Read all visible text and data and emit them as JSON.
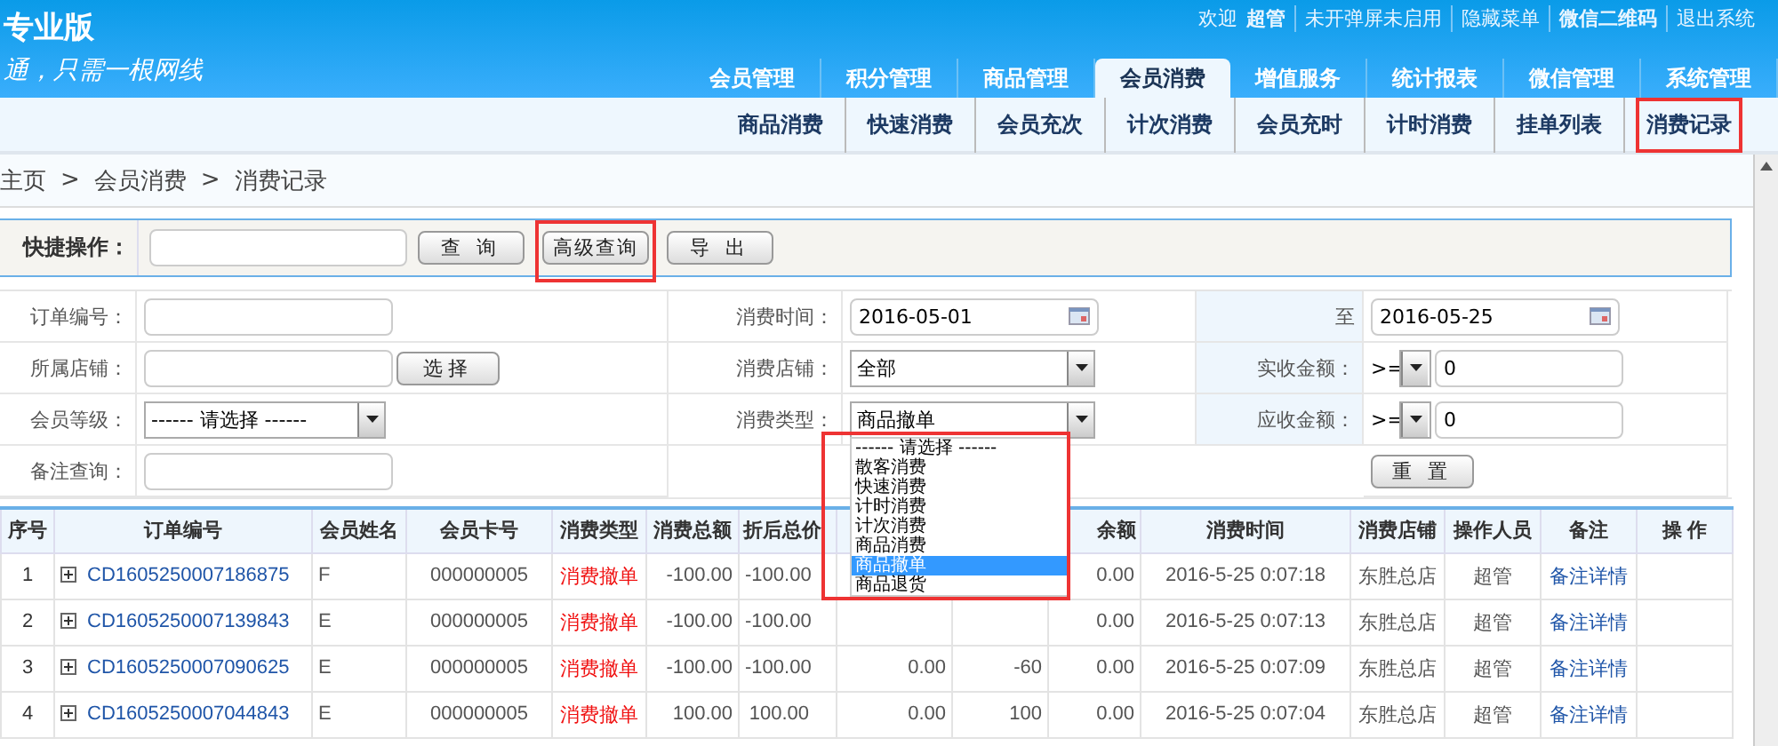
{
  "header": {
    "edition": "专业版",
    "slogan": "通，只需一根网线",
    "top_links": [
      [
        {
          "text": "欢迎",
          "bold": false
        },
        {
          "text": "超管",
          "bold": true
        }
      ],
      [
        {
          "text": "未开弹屏未启用",
          "bold": false
        }
      ],
      [
        {
          "text": "隐藏菜单",
          "bold": false
        }
      ],
      [
        {
          "text": "微信二维码",
          "bold": true
        }
      ],
      [
        {
          "text": "退出系统",
          "bold": false
        }
      ]
    ],
    "nav_tabs": [
      {
        "label": "会员管理",
        "selected": false
      },
      {
        "label": "积分管理",
        "selected": false
      },
      {
        "label": "商品管理",
        "selected": false
      },
      {
        "label": "会员消费",
        "selected": true
      },
      {
        "label": "增值服务",
        "selected": false
      },
      {
        "label": "统计报表",
        "selected": false
      },
      {
        "label": "微信管理",
        "selected": false
      },
      {
        "label": "系统管理",
        "selected": false
      }
    ]
  },
  "sub_nav": [
    {
      "label": "商品消费",
      "highlighted": false
    },
    {
      "label": "快速消费",
      "highlighted": false
    },
    {
      "label": "会员充次",
      "highlighted": false
    },
    {
      "label": "计次消费",
      "highlighted": false
    },
    {
      "label": "会员充时",
      "highlighted": false
    },
    {
      "label": "计时消费",
      "highlighted": false
    },
    {
      "label": "挂单列表",
      "highlighted": false
    },
    {
      "label": "消费记录",
      "highlighted": true
    }
  ],
  "breadcrumb": {
    "separator": ">",
    "items": [
      "主页",
      "会员消费",
      "消费记录"
    ]
  },
  "quick_bar": {
    "label": "快捷操作：",
    "buttons": [
      {
        "label": "查 询",
        "highlighted": false
      },
      {
        "label": "高级查询",
        "highlighted": true
      },
      {
        "label": "导 出",
        "highlighted": false
      }
    ]
  },
  "advanced_form": [
    [
      {
        "kind": "label",
        "text": "订单编号："
      },
      {
        "kind": "input"
      },
      {
        "kind": "label",
        "text": "消费时间："
      },
      {
        "kind": "date",
        "value": "2016-05-01"
      },
      {
        "kind": "label",
        "text": "至"
      },
      {
        "kind": "date",
        "value": "2016-05-25"
      }
    ],
    [
      {
        "kind": "label",
        "text": "所属店铺："
      },
      {
        "kind": "input_button",
        "button": "选择"
      },
      {
        "kind": "label",
        "text": "消费店铺："
      },
      {
        "kind": "select",
        "value": "全部",
        "expanded": false
      },
      {
        "kind": "label",
        "text": "实收金额："
      },
      {
        "kind": "compare",
        "operator": ">=",
        "value": "0"
      }
    ],
    [
      {
        "kind": "label",
        "text": "会员等级："
      },
      {
        "kind": "select",
        "value": "------ 请选择 ------",
        "expanded": false
      },
      {
        "kind": "label",
        "text": "消费类型："
      },
      {
        "kind": "select",
        "value": "商品撤单",
        "expanded": true,
        "highlighted": true,
        "options": [
          {
            "label": "------ 请选择 ------",
            "selected": false
          },
          {
            "label": "散客消费",
            "selected": false
          },
          {
            "label": "快速消费",
            "selected": false
          },
          {
            "label": "计时消费",
            "selected": false
          },
          {
            "label": "计次消费",
            "selected": false
          },
          {
            "label": "商品消费",
            "selected": false
          },
          {
            "label": "商品撤单",
            "selected": true
          },
          {
            "label": "商品退货",
            "selected": false
          }
        ]
      },
      {
        "kind": "label",
        "text": "应收金额："
      },
      {
        "kind": "compare",
        "operator": ">=",
        "value": "0"
      }
    ],
    [
      {
        "kind": "label",
        "text": "备注查询："
      },
      {
        "kind": "input"
      },
      {
        "kind": "empty"
      },
      {
        "kind": "empty"
      },
      {
        "kind": "empty"
      },
      {
        "kind": "button",
        "label": "重 置"
      }
    ]
  ],
  "table": {
    "columns": [
      "序号",
      "订单编号",
      "会员姓名",
      "会员卡号",
      "消费类型",
      "消费总额",
      "折后总价",
      null,
      null,
      "余额",
      "消费时间",
      "消费店铺",
      "操作人员",
      "备注",
      "操 作"
    ],
    "rows": [
      [
        "1",
        "CD1605250007186875",
        "F",
        "000000005",
        "消费撤单",
        "-100.00",
        "-100.00",
        null,
        null,
        "0.00",
        "2016-5-25 0:07:18",
        "东胜总店",
        "超管",
        "备注详情"
      ],
      [
        "2",
        "CD1605250007139843",
        "E",
        "000000005",
        "消费撤单",
        "-100.00",
        "-100.00",
        null,
        null,
        "0.00",
        "2016-5-25 0:07:13",
        "东胜总店",
        "超管",
        "备注详情"
      ],
      [
        "3",
        "CD1605250007090625",
        "E",
        "000000005",
        "消费撤单",
        "-100.00",
        "-100.00",
        "0.00",
        "-60",
        "0.00",
        "2016-5-25 0:07:09",
        "东胜总店",
        "超管",
        "备注详情"
      ],
      [
        "4",
        "CD1605250007044843",
        "E",
        "000000005",
        "消费撤单",
        "100.00",
        "100.00",
        "0.00",
        "100",
        "0.00",
        "2016-5-25 0:07:04",
        "东胜总店",
        "超管",
        "备注详情"
      ]
    ]
  }
}
